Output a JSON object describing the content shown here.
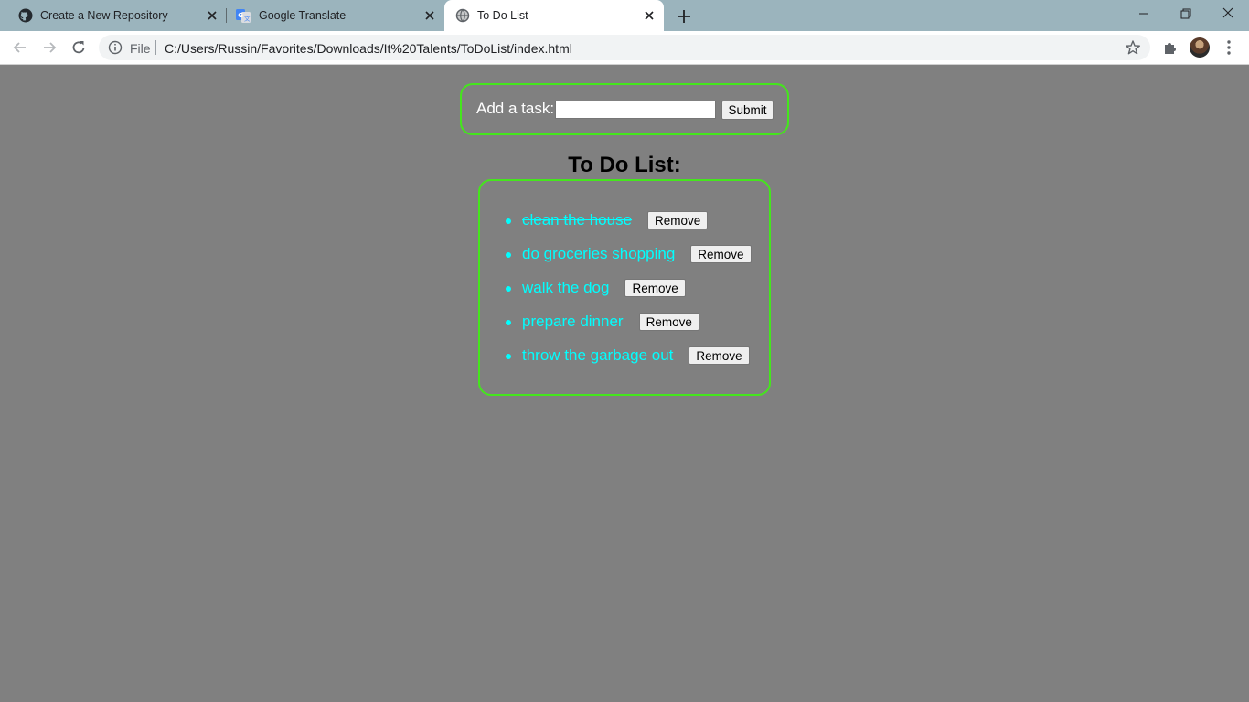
{
  "browser": {
    "tabs": [
      {
        "title": "Create a New Repository",
        "icon": "github-icon",
        "active": false
      },
      {
        "title": "Google Translate",
        "icon": "google-translate-icon",
        "active": false
      },
      {
        "title": "To Do List",
        "icon": "globe-icon",
        "active": true
      }
    ],
    "address_bar": {
      "security_label": "File",
      "url": "C:/Users/Russin/Favorites/Downloads/It%20Talents/ToDoList/index.html"
    }
  },
  "page": {
    "form": {
      "label": "Add a task:",
      "input_value": "",
      "submit_label": "Submit"
    },
    "list_title": "To Do List:",
    "items": [
      {
        "text": "clean the house",
        "completed": true,
        "remove_label": "Remove"
      },
      {
        "text": "do groceries shopping",
        "completed": false,
        "remove_label": "Remove"
      },
      {
        "text": "walk the dog",
        "completed": false,
        "remove_label": "Remove"
      },
      {
        "text": "prepare dinner",
        "completed": false,
        "remove_label": "Remove"
      },
      {
        "text": "throw the garbage out",
        "completed": false,
        "remove_label": "Remove"
      }
    ]
  },
  "colors": {
    "page_background": "#808080",
    "box_border": "#44e61c",
    "item_text": "#00ffff",
    "tab_strip": "#9bb4bd"
  }
}
